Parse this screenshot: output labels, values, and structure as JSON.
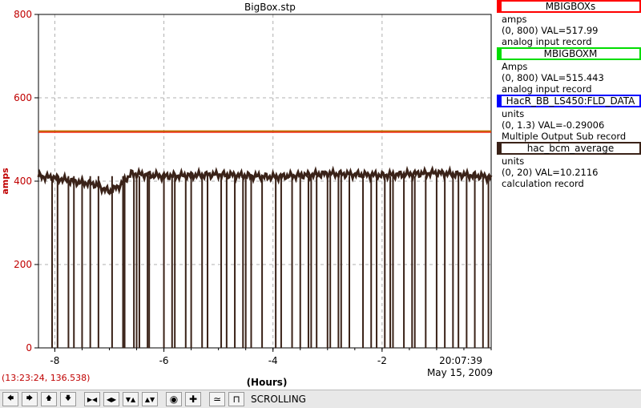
{
  "chart_data": {
    "type": "line",
    "title": "BigBox.stp",
    "ylabel": "amps",
    "xlabel": "(Hours)",
    "xlim": [
      -8.3,
      0
    ],
    "ylim": [
      0,
      800
    ],
    "y_ticks": [
      "0",
      "200",
      "400",
      "600",
      "800"
    ],
    "x_ticks": [
      "-8",
      "-6",
      "-4",
      "-2"
    ],
    "timestamp_time": "20:07:39",
    "timestamp_date": "May 15, 2009",
    "grid": true,
    "series": [
      {
        "name": "MBIGBOXs",
        "color": "#ff0000",
        "values": [
          [
            -8.3,
            517.99
          ],
          [
            0,
            517.99
          ]
        ]
      },
      {
        "name": "MBIGBOXM",
        "color": "#c07000",
        "values": [
          [
            -8.3,
            520
          ],
          [
            0,
            520
          ]
        ]
      },
      {
        "name": "hac_bcm_average",
        "color": "#3a2218",
        "values": [
          [
            -8.3,
            412
          ],
          [
            -8.0,
            408
          ],
          [
            -7.6,
            398
          ],
          [
            -7.3,
            394
          ],
          [
            -7.0,
            375
          ],
          [
            -6.8,
            390
          ],
          [
            -6.6,
            418
          ],
          [
            -6.0,
            412
          ],
          [
            -5.0,
            416
          ],
          [
            -4.0,
            410
          ],
          [
            -3.0,
            418
          ],
          [
            -2.0,
            414
          ],
          [
            -1.0,
            420
          ],
          [
            0,
            410
          ]
        ],
        "drops_x": [
          -8.05,
          -7.95,
          -7.75,
          -7.65,
          -7.5,
          -7.35,
          -7.2,
          -6.95,
          -6.75,
          -6.72,
          -6.55,
          -6.5,
          -6.45,
          -6.3,
          -6.27,
          -6.0,
          -5.85,
          -5.8,
          -5.6,
          -5.5,
          -5.3,
          -5.2,
          -4.95,
          -4.85,
          -4.7,
          -4.55,
          -4.5,
          -4.4,
          -4.2,
          -3.95,
          -3.85,
          -3.65,
          -3.5,
          -3.35,
          -3.3,
          -3.2,
          -3.0,
          -2.95,
          -2.8,
          -2.75,
          -2.6,
          -2.35,
          -2.2,
          -2.1,
          -1.95,
          -1.85,
          -1.8,
          -1.6,
          -1.45,
          -1.4,
          -1.2,
          -1.0,
          -0.85,
          -0.7,
          -0.6,
          -0.45,
          -0.3,
          -0.15,
          -0.05
        ]
      }
    ]
  },
  "legend": [
    {
      "name": "MBIGBOXs",
      "color": "#ff0000",
      "units": "amps",
      "range_value": "(0, 800)  VAL=517.99",
      "record": "analog input record"
    },
    {
      "name": "MBIGBOXM",
      "color": "#00dd00",
      "units": "Amps",
      "range_value": "(0, 800)  VAL=515.443",
      "record": "analog input record"
    },
    {
      "name": "HacR_BB_LS450:FLD_DATA",
      "color": "#0000ff",
      "units": "units",
      "range_value": "(0, 1.3)  VAL=-0.29006",
      "record": "Multiple Output Sub record"
    },
    {
      "name": "hac_bcm_average",
      "color": "#3a2218",
      "units": "units",
      "range_value": "(0, 20)  VAL=10.2116",
      "record": "calculation record"
    }
  ],
  "cursor_readout": "(13:23:24, 136.538)",
  "toolbar": {
    "buttons": [
      {
        "name": "pan-left-button",
        "icon": "arrow-left-icon",
        "glyph": "🡄"
      },
      {
        "name": "pan-right-button",
        "icon": "arrow-right-icon",
        "glyph": "🡆"
      },
      {
        "name": "pan-up-button",
        "icon": "arrow-up-icon",
        "glyph": "🡅"
      },
      {
        "name": "pan-down-button",
        "icon": "arrow-down-icon",
        "glyph": "🡇"
      },
      {
        "name": "zoom-in-x-button",
        "icon": "zoom-in-x-icon",
        "glyph": "▶◀"
      },
      {
        "name": "zoom-out-x-button",
        "icon": "zoom-out-x-icon",
        "glyph": "◀▶"
      },
      {
        "name": "zoom-in-y-button",
        "icon": "zoom-in-y-icon",
        "glyph": "▼▲"
      },
      {
        "name": "zoom-out-y-button",
        "icon": "zoom-out-y-icon",
        "glyph": "▲▼"
      },
      {
        "name": "reset-button",
        "icon": "circle-icon",
        "glyph": "◉"
      },
      {
        "name": "add-button",
        "icon": "plus-icon",
        "glyph": "✚"
      },
      {
        "name": "scroll-mode-button",
        "icon": "wave-icon",
        "glyph": "≃"
      },
      {
        "name": "step-mode-button",
        "icon": "step-icon",
        "glyph": "⊓"
      }
    ],
    "mode_label": "SCROLLING"
  }
}
